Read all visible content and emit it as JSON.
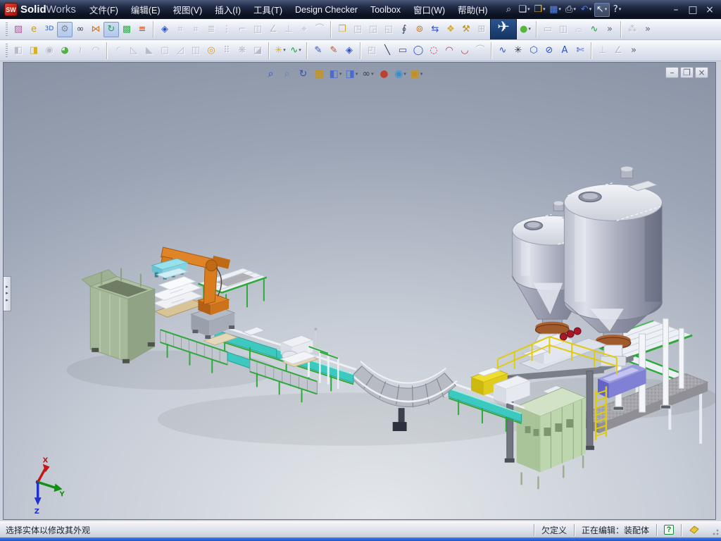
{
  "window": {
    "logo": "SW",
    "app_name_bold": "Solid",
    "app_name_light": "Works"
  },
  "menu_bar": {
    "items": [
      {
        "name": "menu-file",
        "label": "文件(F)"
      },
      {
        "name": "menu-edit",
        "label": "编辑(E)"
      },
      {
        "name": "menu-view",
        "label": "视图(V)"
      },
      {
        "name": "menu-insert",
        "label": "插入(I)"
      },
      {
        "name": "menu-tools",
        "label": "工具(T)"
      },
      {
        "name": "menu-design-checker",
        "label": "Design Checker"
      },
      {
        "name": "menu-toolbox",
        "label": "Toolbox"
      },
      {
        "name": "menu-window",
        "label": "窗口(W)"
      },
      {
        "name": "menu-help",
        "label": "帮助(H)"
      }
    ]
  },
  "standard_toolbar": {
    "items": [
      {
        "name": "search-icon",
        "glyph": "⌕",
        "color": "#c8cede"
      },
      {
        "name": "new-document-button",
        "glyph": "❏",
        "color": "#e9edf7",
        "dropdown": true
      },
      {
        "name": "open-button",
        "glyph": "❒",
        "color": "#e8b43a",
        "dropdown": true
      },
      {
        "name": "save-button",
        "glyph": "▦",
        "color": "#5a86e8",
        "dropdown": true
      },
      {
        "name": "print-button",
        "glyph": "⎙",
        "color": "#d0d6e6",
        "dropdown": true
      },
      {
        "name": "undo-button",
        "glyph": "↶",
        "color": "#4a78f0",
        "dropdown": true
      },
      {
        "name": "select-button",
        "glyph": "↖",
        "color": "#f0f2f8",
        "dropdown": true,
        "state": "pressed"
      },
      {
        "name": "help-button",
        "glyph": "?",
        "color": "#e9edf7",
        "dropdown": true
      }
    ]
  },
  "window_controls": {
    "items": [
      {
        "name": "minimize-button",
        "glyph": "–"
      },
      {
        "name": "maximize-button",
        "glyph": "□"
      },
      {
        "name": "close-button",
        "glyph": "×"
      }
    ]
  },
  "tools_toolbar": {
    "items": [
      {
        "type": "handle"
      },
      {
        "name": "photoworks-icon",
        "glyph": "▨",
        "color": "#b05a9a"
      },
      {
        "name": "edrawings-icon",
        "glyph": "e",
        "color": "#c8a012"
      },
      {
        "name": "3d-content-icon",
        "glyph": "3D",
        "color": "#2858c8"
      },
      {
        "name": "toolbox-browser-icon",
        "glyph": "⚙",
        "color": "#7e879c",
        "state": "pressed"
      },
      {
        "name": "design-checker-icon",
        "glyph": "∞",
        "color": "#3a4258"
      },
      {
        "name": "routing-icon",
        "glyph": "⋈",
        "color": "#d07828"
      },
      {
        "name": "verification-icon",
        "glyph": "↻",
        "color": "#28a048",
        "state": "pressed"
      },
      {
        "name": "realview-cube-icon",
        "glyph": "▩",
        "color": "#30b050"
      },
      {
        "name": "photoview-icon",
        "glyph": "≡",
        "color": "#d04818"
      },
      {
        "type": "sep"
      },
      {
        "name": "smart-dimension-icon",
        "glyph": "◈",
        "color": "#2a52c8"
      },
      {
        "name": "horizontal-dimension-icon",
        "glyph": "⌗",
        "state": "disabled"
      },
      {
        "name": "vertical-dimension-icon",
        "glyph": "⌗",
        "state": "disabled"
      },
      {
        "name": "baseline-dimension-icon",
        "glyph": "≣",
        "state": "disabled"
      },
      {
        "name": "ordinate-dimension-icon",
        "glyph": "⋮",
        "state": "disabled"
      },
      {
        "name": "chamfer-dimension-icon",
        "glyph": "⌐",
        "state": "disabled"
      },
      {
        "name": "auto-dimension-icon",
        "glyph": "◫",
        "state": "disabled"
      },
      {
        "name": "angle-dimension-icon",
        "glyph": "∠",
        "state": "disabled"
      },
      {
        "name": "perpendicular-icon",
        "glyph": "⊥",
        "state": "disabled"
      },
      {
        "name": "geometric-tolerance-icon",
        "glyph": "⌖",
        "state": "disabled"
      },
      {
        "name": "weld-symbol-icon",
        "glyph": "⌒",
        "state": "disabled"
      },
      {
        "type": "sep"
      },
      {
        "name": "open-assembly-icon",
        "glyph": "❒",
        "color": "#d8a830"
      },
      {
        "name": "make-drawing-icon",
        "glyph": "◳",
        "state": "disabled"
      },
      {
        "name": "make-assembly-icon",
        "glyph": "◲",
        "state": "disabled"
      },
      {
        "name": "publish-icon",
        "glyph": "◱",
        "state": "disabled"
      },
      {
        "name": "attachments-icon",
        "glyph": "∮",
        "color": "#3a4258"
      },
      {
        "name": "lights-camera-icon",
        "glyph": "⊚",
        "color": "#c07828"
      },
      {
        "name": "reload-icon",
        "glyph": "⇆",
        "color": "#2a52c8"
      },
      {
        "name": "new-window-icon",
        "glyph": "❖",
        "color": "#d8a830"
      },
      {
        "name": "component-tools-icon",
        "glyph": "⚒",
        "color": "#c09020"
      },
      {
        "name": "smartmates-icon",
        "glyph": "⊞",
        "state": "disabled"
      },
      {
        "name": "lightweight-toggle",
        "glyph": "✈",
        "color": "#f4f8fc",
        "state": "pressed-large"
      },
      {
        "name": "appearance-sphere-icon",
        "glyph": "●",
        "color": "#52b838",
        "dropdown": true
      },
      {
        "type": "sep"
      },
      {
        "name": "drawing-sheet-icon",
        "glyph": "▭",
        "state": "disabled"
      },
      {
        "name": "model-view-icon",
        "glyph": "◫",
        "state": "disabled"
      },
      {
        "name": "projected-view-icon",
        "glyph": "⌓",
        "state": "disabled"
      },
      {
        "name": "route-line-icon",
        "glyph": "∿",
        "color": "#18a038"
      },
      {
        "name": "overflow-chevron-icon",
        "glyph": "»",
        "color": "#5a6278"
      },
      {
        "type": "sep"
      },
      {
        "name": "exploded-view-icon",
        "glyph": "⁂",
        "state": "disabled"
      },
      {
        "name": "overflow-chevron-icon",
        "glyph": "»",
        "color": "#5a6278"
      }
    ]
  },
  "features_sketch_toolbar": {
    "items": [
      {
        "type": "handle"
      },
      {
        "name": "extruded-boss-icon",
        "glyph": "◧",
        "state": "disabled"
      },
      {
        "name": "extruded-cut-icon",
        "glyph": "◨",
        "color": "#d8b020"
      },
      {
        "name": "revolved-boss-icon",
        "glyph": "◉",
        "state": "disabled"
      },
      {
        "name": "revolved-cut-icon",
        "glyph": "◕",
        "color": "#50b040"
      },
      {
        "name": "swept-boss-icon",
        "glyph": "≀",
        "state": "disabled"
      },
      {
        "name": "lofted-boss-icon",
        "glyph": "◠",
        "state": "disabled"
      },
      {
        "type": "sep"
      },
      {
        "name": "fillet-icon",
        "glyph": "◜",
        "state": "disabled"
      },
      {
        "name": "chamfer-icon",
        "glyph": "◺",
        "state": "disabled"
      },
      {
        "name": "rib-icon",
        "glyph": "◣",
        "state": "disabled"
      },
      {
        "name": "shell-icon",
        "glyph": "▢",
        "state": "disabled"
      },
      {
        "name": "draft-icon",
        "glyph": "◿",
        "state": "disabled"
      },
      {
        "name": "mirror-feature-icon",
        "glyph": "◫",
        "state": "disabled"
      },
      {
        "name": "hole-wizard-icon",
        "glyph": "◎",
        "color": "#d8a020"
      },
      {
        "name": "linear-pattern-icon",
        "glyph": "⠿",
        "state": "disabled"
      },
      {
        "name": "circular-pattern-icon",
        "glyph": "❋",
        "state": "disabled"
      },
      {
        "name": "mirror-pattern-icon",
        "glyph": "◪",
        "state": "disabled"
      },
      {
        "type": "sep"
      },
      {
        "name": "reference-geometry-icon",
        "glyph": "✳",
        "color": "#d8b020",
        "dropdown": true
      },
      {
        "name": "curves-icon",
        "glyph": "∿",
        "color": "#18a038",
        "dropdown": true
      },
      {
        "type": "sep"
      },
      {
        "name": "sketch-icon",
        "glyph": "✎",
        "color": "#3050c0"
      },
      {
        "name": "3d-sketch-icon",
        "glyph": "✎",
        "color": "#c05020"
      },
      {
        "name": "sketch-dimension-icon",
        "glyph": "◈",
        "color": "#2a52c8"
      },
      {
        "type": "sep"
      },
      {
        "name": "convert-entities-icon",
        "glyph": "◰",
        "state": "disabled"
      },
      {
        "name": "line-icon",
        "glyph": "╲",
        "color": "#283048"
      },
      {
        "name": "rectangle-icon",
        "glyph": "▭",
        "color": "#2a52c8"
      },
      {
        "name": "circle-icon",
        "glyph": "◯",
        "color": "#2a52c8"
      },
      {
        "name": "perimeter-circle-icon",
        "glyph": "◌",
        "color": "#c03040"
      },
      {
        "name": "centerpoint-arc-icon",
        "glyph": "◠",
        "color": "#c03040"
      },
      {
        "name": "tangent-arc-icon",
        "glyph": "◡",
        "color": "#c03040"
      },
      {
        "name": "three-point-arc-icon",
        "glyph": "⌒",
        "state": "disabled"
      },
      {
        "type": "sep"
      },
      {
        "name": "spline-icon",
        "glyph": "∿",
        "color": "#2a52c8"
      },
      {
        "name": "point-icon",
        "glyph": "✳",
        "color": "#283048"
      },
      {
        "name": "polygon-icon",
        "glyph": "⬡",
        "color": "#2a52c8"
      },
      {
        "name": "ellipse-icon",
        "glyph": "⊘",
        "color": "#2a52c8"
      },
      {
        "name": "sketch-text-icon",
        "glyph": "A",
        "color": "#2a52c8"
      },
      {
        "name": "trim-entities-icon",
        "glyph": "✄",
        "color": "#2a52c8"
      },
      {
        "type": "sep"
      },
      {
        "name": "add-relation-icon",
        "glyph": "⊥",
        "state": "disabled"
      },
      {
        "name": "display-relations-icon",
        "glyph": "∠",
        "state": "disabled"
      },
      {
        "name": "overflow-chevron-icon",
        "glyph": "»",
        "color": "#5a6278"
      }
    ]
  },
  "view_toolbar": {
    "items": [
      {
        "name": "zoom-fit-icon",
        "glyph": "⌕",
        "color": "#3050c0"
      },
      {
        "name": "zoom-area-icon",
        "glyph": "⌕",
        "color": "#6078c8"
      },
      {
        "name": "rotate-view-icon",
        "glyph": "↻",
        "color": "#3050c0"
      },
      {
        "name": "section-view-icon",
        "glyph": "▥",
        "color": "#c09020"
      },
      {
        "name": "view-orientation-icon",
        "glyph": "◧",
        "color": "#4a6ad0",
        "dropdown": true
      },
      {
        "name": "display-style-icon",
        "glyph": "◨",
        "color": "#4a6ad0",
        "dropdown": true
      },
      {
        "name": "hide-show-icon",
        "glyph": "∞",
        "color": "#3a4258",
        "dropdown": true
      },
      {
        "name": "apply-scene-icon",
        "glyph": "●",
        "color": "#c04030"
      },
      {
        "name": "view-settings-icon",
        "glyph": "◉",
        "color": "#3090d0",
        "dropdown": true
      },
      {
        "name": "camera-icon",
        "glyph": "▣",
        "color": "#c09020",
        "dropdown": true
      }
    ]
  },
  "child_window_controls": {
    "items": [
      {
        "name": "child-minimize-button",
        "glyph": "–"
      },
      {
        "name": "child-restore-button",
        "glyph": "❐"
      },
      {
        "name": "child-close-button",
        "glyph": "×"
      }
    ]
  },
  "panel_tab": {
    "glyph": "▸"
  },
  "viewport": {
    "triad": {
      "x": "X",
      "y": "Y",
      "z": "Z"
    }
  },
  "status_bar": {
    "message": "选择实体以修改其外观",
    "constraint_status": "欠定义",
    "editing_status": "正在编辑：装配体",
    "quick_tips_glyph": "?"
  },
  "colors": {
    "accent_blue": "#2a52c8",
    "conveyor_green": "#2fa83c",
    "belt_teal": "#3cc9c0",
    "robot_orange": "#d87c1e",
    "selection_blue": "#1e4a8c",
    "status_strip_blue": "#2563dc"
  }
}
